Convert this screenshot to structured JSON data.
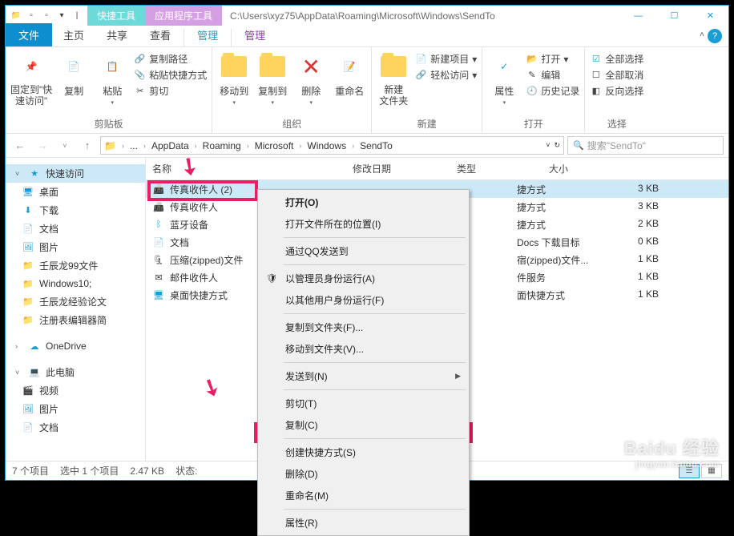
{
  "title_path": "C:\\Users\\xyz75\\AppData\\Roaming\\Microsoft\\Windows\\SendTo",
  "tool_tabs": {
    "t1": "快捷工具",
    "t2": "应用程序工具",
    "sub1": "管理",
    "sub2": "管理"
  },
  "win_btns": {
    "min": "—",
    "max": "☐",
    "close": "✕"
  },
  "menu": {
    "file": "文件",
    "home": "主页",
    "share": "共享",
    "view": "查看"
  },
  "ribbon": {
    "pin": {
      "label": "固定到\"快\n速访问\""
    },
    "copy": {
      "label": "复制"
    },
    "paste": {
      "label": "粘贴"
    },
    "paste_side": {
      "path": "复制路径",
      "shortcut": "粘贴快捷方式",
      "cut": "剪切"
    },
    "g1": "剪贴板",
    "moveto": "移动到",
    "copyto": "复制到",
    "delete": "删除",
    "rename": "重命名",
    "g2": "组织",
    "newfolder": "新建\n文件夹",
    "new_side": {
      "item": "新建项目",
      "easy": "轻松访问"
    },
    "g3": "新建",
    "props": "属性",
    "open_side": {
      "open": "打开",
      "edit": "编辑",
      "history": "历史记录"
    },
    "g4": "打开",
    "sel_side": {
      "all": "全部选择",
      "none": "全部取消",
      "inv": "反向选择"
    },
    "g5": "选择"
  },
  "breadcrumb": [
    "AppData",
    "Roaming",
    "Microsoft",
    "Windows",
    "SendTo"
  ],
  "search_placeholder": "搜索\"SendTo\"",
  "nav": {
    "quick": "快速访问",
    "desktop": "桌面",
    "downloads": "下载",
    "documents": "文档",
    "pictures": "图片",
    "f1": "壬辰龙99文件",
    "f2": "Windows10;",
    "f3": "壬辰龙经验论文",
    "f4": "注册表编辑器简",
    "onedrive": "OneDrive",
    "thispc": "此电脑",
    "videos": "视频",
    "pictures2": "图片",
    "documents2": "文档"
  },
  "cols": {
    "name": "名称",
    "modified": "修改日期",
    "type": "类型",
    "size": "大小"
  },
  "files": [
    {
      "name": "传真收件人 (2)",
      "type": "捷方式",
      "size": "3 KB"
    },
    {
      "name": "传真收件人",
      "type": "捷方式",
      "size": "3 KB"
    },
    {
      "name": "蓝牙设备",
      "type": "捷方式",
      "size": "2 KB"
    },
    {
      "name": "文档",
      "type": "Docs 下载目标",
      "size": "0 KB"
    },
    {
      "name": "压缩(zipped)文件",
      "type": "宿(zipped)文件...",
      "size": "1 KB"
    },
    {
      "name": "邮件收件人",
      "type": "件服务",
      "size": "1 KB"
    },
    {
      "name": "桌面快捷方式",
      "type": "面快捷方式",
      "size": "1 KB"
    }
  ],
  "ctx": {
    "open": "打开(O)",
    "openloc": "打开文件所在的位置(I)",
    "qq": "通过QQ发送到",
    "admin": "以管理员身份运行(A)",
    "otheruser": "以其他用户身份运行(F)",
    "copyto": "复制到文件夹(F)...",
    "moveto": "移动到文件夹(V)...",
    "sendto": "发送到(N)",
    "cut": "剪切(T)",
    "copy": "复制(C)",
    "shortcut": "创建快捷方式(S)",
    "delete": "删除(D)",
    "rename": "重命名(M)",
    "props": "属性(R)"
  },
  "status": {
    "count": "7 个项目",
    "sel": "选中 1 个项目",
    "size": "2.47 KB",
    "state": "状态:"
  },
  "watermark": {
    "brand": "Baidu 经验",
    "url": "jingyan.baidu.com"
  }
}
